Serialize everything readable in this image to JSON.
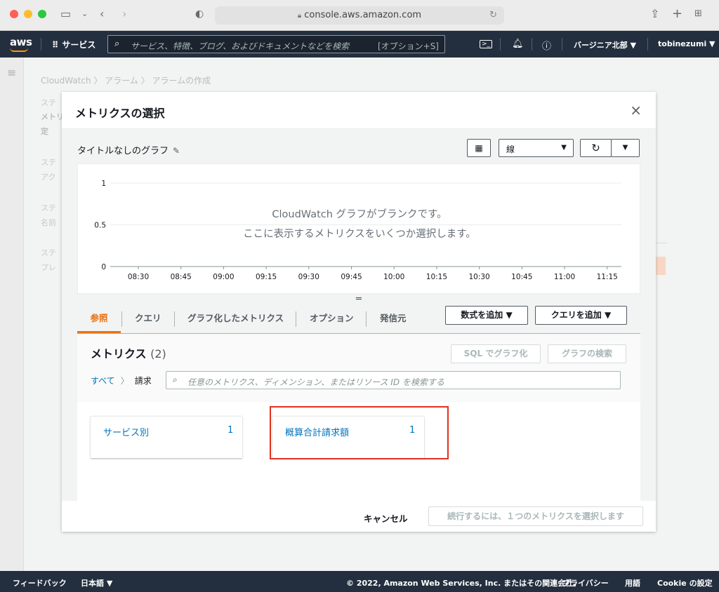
{
  "browser": {
    "url": "console.aws.amazon.com"
  },
  "aws_header": {
    "logo": "aws",
    "services": "サービス",
    "search_placeholder": "サービス、特徴、ブログ、およびドキュメントなどを検索",
    "search_shortcut": "[オプション+S]",
    "region": "バージニア北部 ▼",
    "user": "tobinezumi ▼"
  },
  "background": {
    "breadcrumb": "CloudWatch 〉 アラーム 〉 アラームの作成",
    "steps": [
      "ステ",
      "メトリ",
      "定",
      "ステ",
      "アク",
      "ステ",
      "名前",
      "ステ",
      "プレ"
    ]
  },
  "modal": {
    "title": "メトリクスの選択",
    "close": "×",
    "graph_title": "タイトルなしのグラフ",
    "graph_type": "線",
    "blank_message_line1": "CloudWatch グラフがブランクです。",
    "blank_message_line2": "ここに表示するメトリクスをいくつか選択します。",
    "tabs": [
      {
        "label": "参照",
        "active": true
      },
      {
        "label": "クエリ",
        "active": false
      },
      {
        "label": "グラフ化したメトリクス",
        "active": false
      },
      {
        "label": "オプション",
        "active": false
      },
      {
        "label": "発信元",
        "active": false
      }
    ],
    "add_formula": "数式を追加 ▼",
    "add_query": "クエリを追加 ▼",
    "metrics_title": "メトリクス",
    "metrics_count": "(2)",
    "sql_graph": "SQL でグラフ化",
    "graph_search": "グラフの検索",
    "crumb_all": "すべて",
    "crumb_current": "請求",
    "search_placeholder": "任意のメトリクス、ディメンション、またはリソース ID を検索する",
    "tiles": [
      {
        "name": "サービス別",
        "count": "1"
      },
      {
        "name": "概算合計請求額",
        "count": "1"
      }
    ],
    "cancel": "キャンセル",
    "continue": "続行するには、１つのメトリクスを選択します"
  },
  "chart_data": {
    "type": "line",
    "title": "",
    "x": [
      "08:30",
      "08:45",
      "09:00",
      "09:15",
      "09:30",
      "09:45",
      "10:00",
      "10:15",
      "10:30",
      "10:45",
      "11:00",
      "11:15"
    ],
    "y_ticks": [
      "1",
      "0.5",
      "0"
    ],
    "ylim": [
      0,
      1
    ],
    "series": [],
    "grid": true
  },
  "footer": {
    "feedback": "フィードバック",
    "language": "日本語 ▼",
    "copyright": "© 2022, Amazon Web Services, Inc. またはその関連会社。",
    "privacy": "プライバシー",
    "terms": "用語",
    "cookie": "Cookie の設定"
  },
  "colors": {
    "aws_dark": "#232f3e",
    "accent_orange": "#ec7211",
    "link_blue": "#0073bb",
    "highlight_red": "#e0311f"
  }
}
